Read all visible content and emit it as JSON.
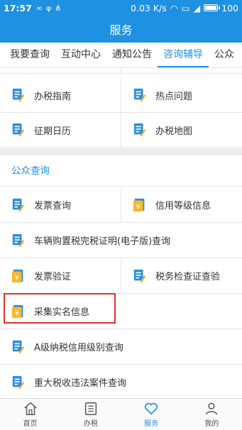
{
  "status": {
    "time": "17:57",
    "speed": "0.03 K/s",
    "battery": "100"
  },
  "title": "服务",
  "tabs": [
    {
      "label": "我要查询"
    },
    {
      "label": "互动中心"
    },
    {
      "label": "通知公告"
    },
    {
      "label": "咨询辅导",
      "active": true
    },
    {
      "label": "公众"
    }
  ],
  "grid1": [
    {
      "label": "办税指南",
      "icon": "document-edit-icon"
    },
    {
      "label": "热点问题",
      "icon": "document-edit-icon"
    },
    {
      "label": "征期日历",
      "icon": "document-edit-icon"
    },
    {
      "label": "办税地图",
      "icon": "document-edit-icon"
    }
  ],
  "section_title": "公众查询",
  "grid2": [
    {
      "label": "发票查询",
      "icon": "document-edit-icon"
    },
    {
      "label": "信用等级信息",
      "icon": "yuan-document-icon"
    },
    {
      "label": "车辆购置税完税证明(电子版)查询",
      "icon": "document-edit-icon"
    },
    {
      "label": "发票验证",
      "icon": "yuan-document-icon"
    },
    {
      "label": "税务检查证查验",
      "icon": "document-edit-icon"
    },
    {
      "label": "采集实名信息",
      "icon": "yuan-document-icon"
    },
    {
      "label": "A级纳税信用级别查询",
      "icon": "document-edit-icon"
    },
    {
      "label": "重大税收违法案件查询",
      "icon": "document-edit-icon"
    }
  ],
  "bottom_nav": [
    {
      "label": "首页",
      "icon": "home-icon"
    },
    {
      "label": "办税",
      "icon": "list-icon"
    },
    {
      "label": "服务",
      "icon": "heart-icon",
      "active": true
    },
    {
      "label": "我的",
      "icon": "person-icon"
    }
  ],
  "colors": {
    "primary": "#1f91e3",
    "highlight": "#e0312b"
  }
}
